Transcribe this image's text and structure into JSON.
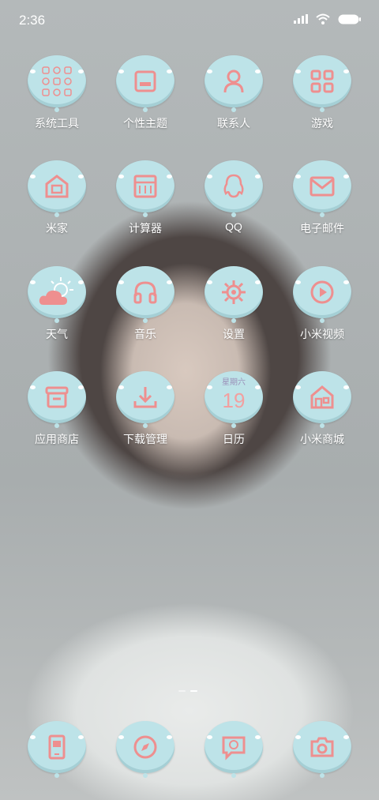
{
  "status_bar": {
    "time": "2:36"
  },
  "apps": [
    {
      "label": "系统工具",
      "icon": "system-tools-folder-icon"
    },
    {
      "label": "个性主题",
      "icon": "themes-icon"
    },
    {
      "label": "联系人",
      "icon": "contacts-icon"
    },
    {
      "label": "游戏",
      "icon": "games-grid-icon"
    },
    {
      "label": "米家",
      "icon": "mi-home-icon"
    },
    {
      "label": "计算器",
      "icon": "calculator-icon"
    },
    {
      "label": "QQ",
      "icon": "qq-penguin-icon"
    },
    {
      "label": "电子邮件",
      "icon": "email-icon"
    },
    {
      "label": "天气",
      "icon": "weather-icon"
    },
    {
      "label": "音乐",
      "icon": "headphones-icon"
    },
    {
      "label": "设置",
      "icon": "settings-gear-icon"
    },
    {
      "label": "小米视频",
      "icon": "video-play-icon"
    },
    {
      "label": "应用商店",
      "icon": "app-store-icon"
    },
    {
      "label": "下载管理",
      "icon": "download-icon"
    },
    {
      "label": "日历",
      "icon": "calendar-icon"
    },
    {
      "label": "小米商城",
      "icon": "mi-store-icon"
    }
  ],
  "calendar": {
    "weekday": "星期六",
    "day": "19"
  },
  "dock": [
    {
      "icon": "phone-icon"
    },
    {
      "icon": "browser-icon"
    },
    {
      "icon": "messages-icon"
    },
    {
      "icon": "camera-icon"
    }
  ],
  "colors": {
    "bubble": "#bde3e8",
    "icon_pink": "#ee8f8f",
    "label": "#ffffff"
  }
}
